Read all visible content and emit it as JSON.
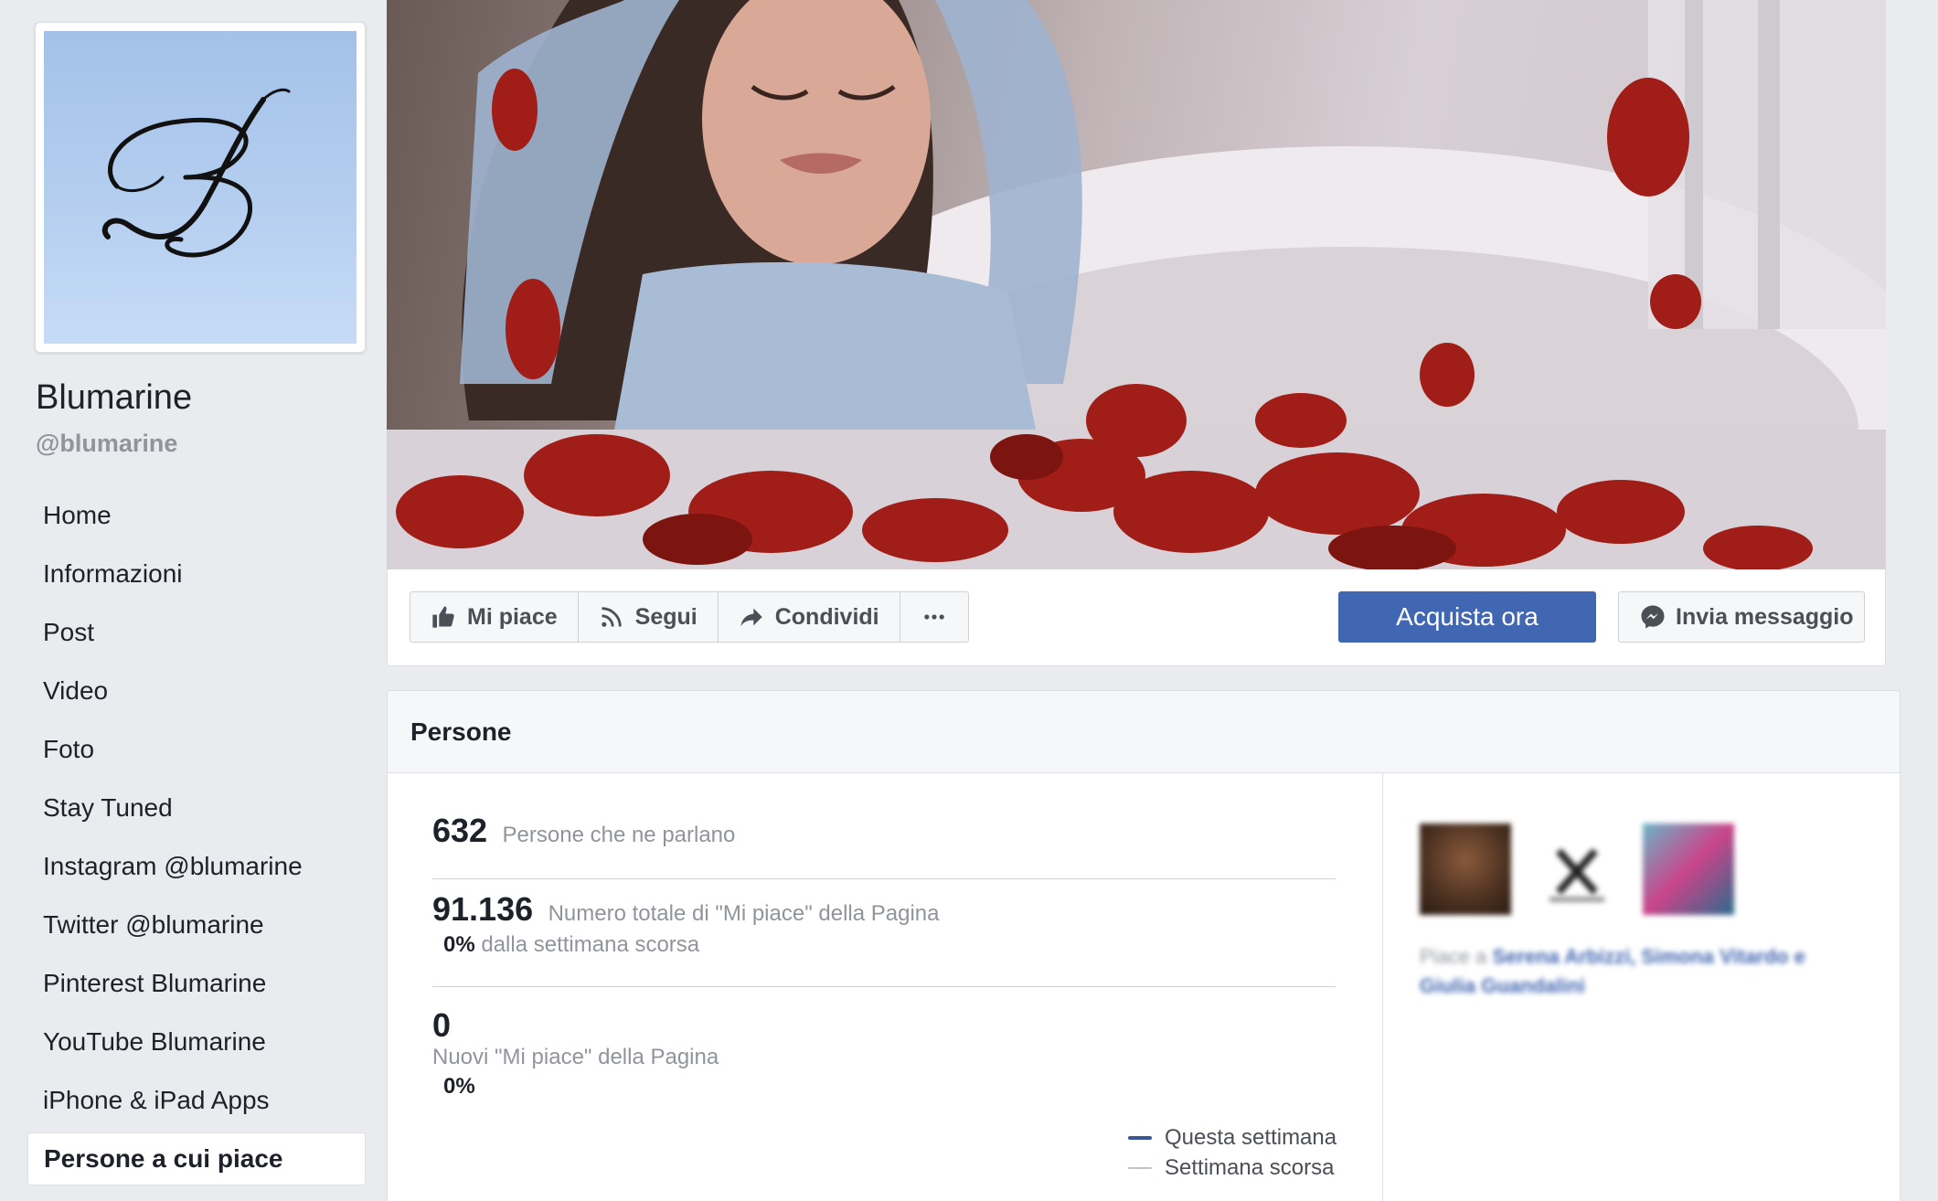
{
  "sidebar": {
    "page_name": "Blumarine",
    "handle": "@blumarine",
    "nav": [
      {
        "label": "Home"
      },
      {
        "label": "Informazioni"
      },
      {
        "label": "Post"
      },
      {
        "label": "Video"
      },
      {
        "label": "Foto"
      },
      {
        "label": "Stay Tuned"
      },
      {
        "label": "Instagram @blumarine"
      },
      {
        "label": "Twitter @blumarine"
      },
      {
        "label": "Pinterest Blumarine"
      },
      {
        "label": "YouTube Blumarine"
      },
      {
        "label": "iPhone & iPad Apps"
      },
      {
        "label": "Persone a cui piace"
      }
    ],
    "active_item": "Persone a cui piace"
  },
  "action_bar": {
    "like_label": "Mi piace",
    "follow_label": "Segui",
    "share_label": "Condividi",
    "more_label": "···",
    "shop_label": "Acquista ora",
    "message_label": "Invia messaggio"
  },
  "people": {
    "title": "Persone",
    "talking_count": "632",
    "talking_label": "Persone che ne parlano",
    "total_likes": "91.136",
    "total_likes_label": "Numero totale di \"Mi piace\" della Pagina",
    "total_likes_change": "0%",
    "total_likes_change_label": "dalla settimana scorsa",
    "new_likes": "0",
    "new_likes_label": "Nuovi \"Mi piace\" della Pagina",
    "new_likes_change": "0%",
    "legend_this_week": "Questa settimana",
    "legend_last_week": "Settimana scorsa"
  },
  "friends_like": {
    "prefix": "Piace a",
    "names": "Serena Arbizzi, Simona Vitardo e Giulia Guandalini"
  },
  "colors": {
    "brand_blue": "#4267b2",
    "background": "#e9ebee",
    "profile_bg": "#b3cdef"
  },
  "icons": {
    "like": "thumbs-up-icon",
    "follow": "rss-icon",
    "share": "share-arrow-icon",
    "more": "ellipsis-icon",
    "message": "messenger-icon"
  }
}
